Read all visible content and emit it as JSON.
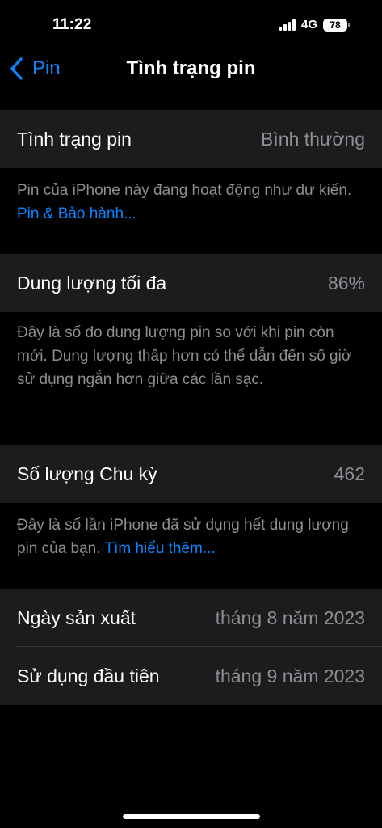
{
  "status_bar": {
    "time": "11:22",
    "network": "4G",
    "battery_level": "78"
  },
  "nav": {
    "back_label": "Pin",
    "title": "Tình trạng pin"
  },
  "battery_health": {
    "label": "Tình trạng pin",
    "value": "Bình thường",
    "footer_text": "Pin của iPhone này đang hoạt động như dự kiến. ",
    "footer_link": "Pin & Bảo hành..."
  },
  "max_capacity": {
    "label": "Dung lượng tối đa",
    "value": "86%",
    "footer_text": "Đây là số đo dung lượng pin so với khi pin còn mới. Dung lượng thấp hơn có thể dẫn đến số giờ sử dụng ngắn hơn giữa các lần sạc."
  },
  "cycle_count": {
    "label": "Số lượng Chu kỳ",
    "value": "462",
    "footer_text": "Đây là số lần iPhone đã sử dụng hết dung lượng pin của bạn. ",
    "footer_link": "Tìm hiểu thêm..."
  },
  "dates": {
    "manufacture_label": "Ngày sản xuất",
    "manufacture_value": "tháng 8 năm 2023",
    "first_use_label": "Sử dụng đầu tiên",
    "first_use_value": "tháng 9 năm 2023"
  },
  "colors": {
    "accent": "#0a84ff",
    "background": "#000000",
    "cell": "#1c1c1e",
    "secondary_text": "#8e8e93"
  }
}
